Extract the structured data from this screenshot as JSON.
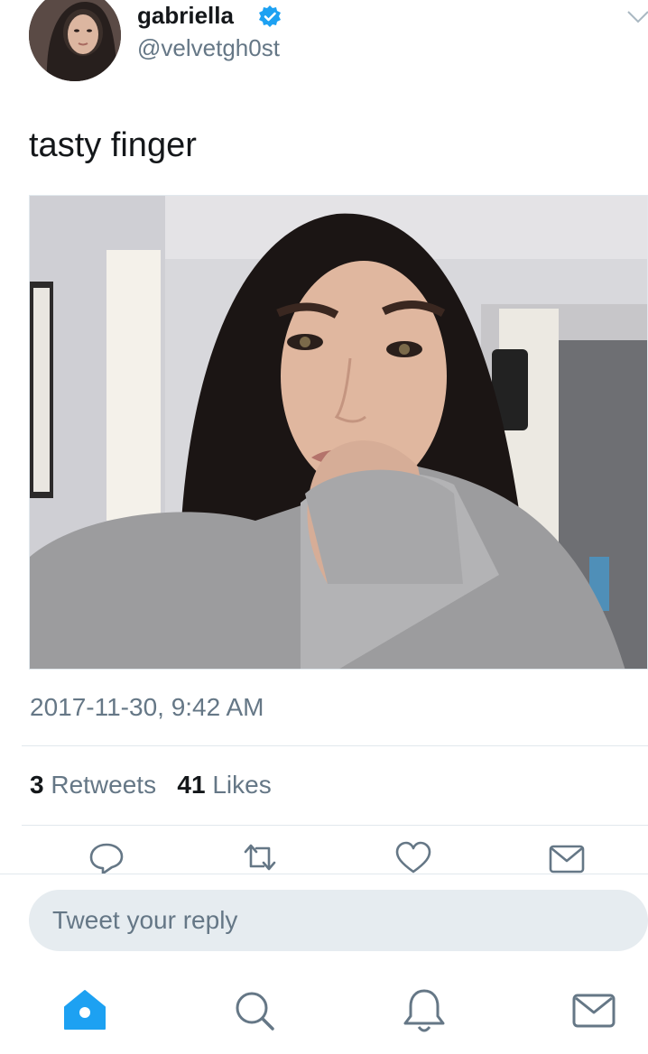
{
  "author": {
    "name": "gabriella",
    "handle": "@velvetgh0st",
    "verified": true
  },
  "tweet": {
    "text": "tasty finger",
    "timestamp": "2017-11-30, 9:42 AM",
    "retweets_count": "3",
    "retweets_label": "Retweets",
    "likes_count": "41",
    "likes_label": "Likes"
  },
  "reply": {
    "placeholder": "Tweet your reply"
  },
  "icons": {
    "actions": [
      "reply-icon",
      "retweet-icon",
      "like-icon",
      "share-icon"
    ],
    "tabs": [
      "home-icon",
      "search-icon",
      "notifications-icon",
      "messages-icon"
    ]
  },
  "colors": {
    "accent": "#1da1f2",
    "secondary_text": "#657786",
    "icon_gray": "#657786",
    "reply_bg": "#e6ecf0"
  }
}
